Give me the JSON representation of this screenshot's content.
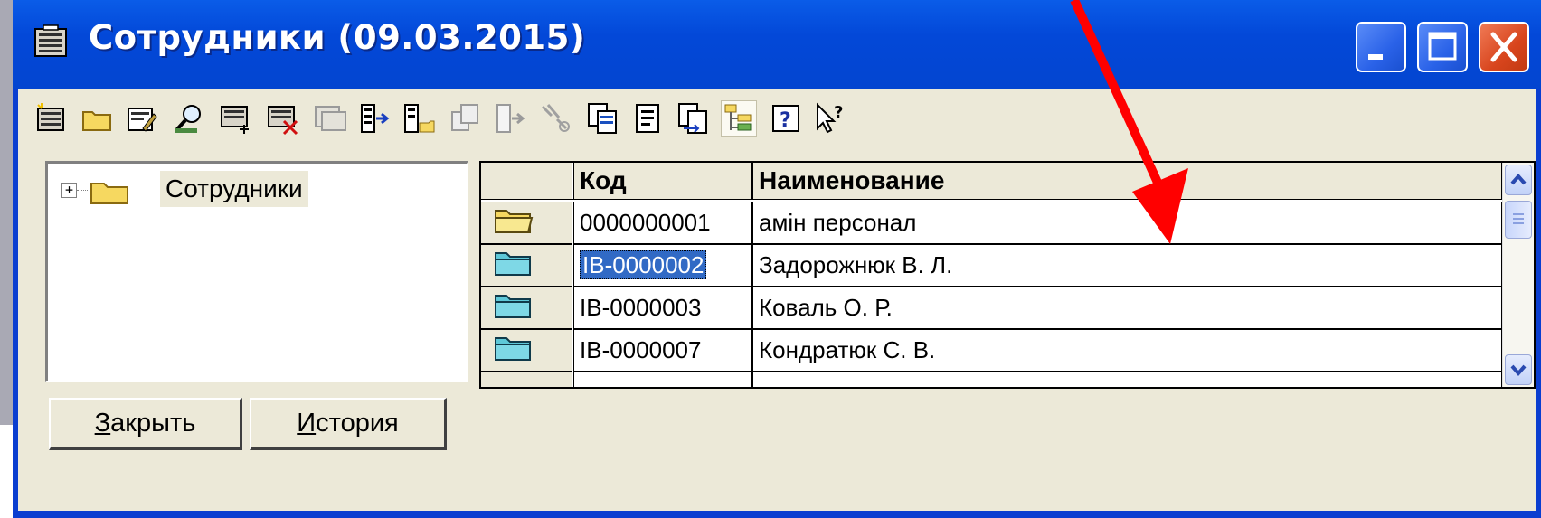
{
  "window": {
    "title": "Сотрудники (09.03.2015)"
  },
  "title_buttons": [
    "minimize-icon",
    "maximize-icon",
    "close-icon"
  ],
  "toolbar": {
    "icons": [
      "new-item-icon",
      "new-group-icon",
      "edit-icon",
      "find-icon",
      "add-row-icon",
      "delete-row-icon",
      "copy-row-icon",
      "move-icon",
      "move-to-group-icon",
      "group-icon",
      "move-down-icon",
      "filter-icon",
      "copy-icon",
      "sheet-icon",
      "transfer-icon",
      "hierarchy-icon",
      "help-icon",
      "context-help-icon"
    ]
  },
  "tree": {
    "expander": "+",
    "root_label": "Сотрудники"
  },
  "grid": {
    "columns": [
      "",
      "Код",
      "Наименование"
    ],
    "rows": [
      {
        "icon": "open-folder-icon",
        "code": "0000000001",
        "name": "амін персонал"
      },
      {
        "icon": "folder-icon",
        "code": "IB-0000002",
        "name": "Задорожнюк В. Л.",
        "selected": true
      },
      {
        "icon": "folder-icon",
        "code": "IB-0000003",
        "name": "Коваль О. Р."
      },
      {
        "icon": "folder-icon",
        "code": "IB-0000007",
        "name": "Кондратюк С. В."
      }
    ]
  },
  "buttons": {
    "close": {
      "accel": "З",
      "rest": "акрыть"
    },
    "history": {
      "accel": "И",
      "rest": "стория"
    }
  },
  "colors": {
    "titlebar": "#0348d8",
    "face": "#ece9d8",
    "selection": "#316ac5",
    "annotation_arrow": "#ff0000"
  }
}
